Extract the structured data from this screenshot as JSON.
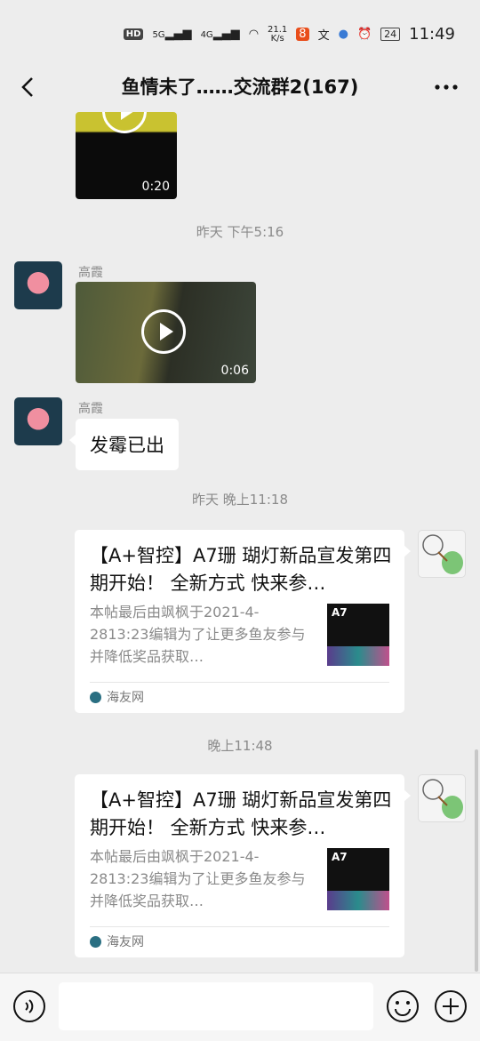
{
  "status": {
    "hd": "HD",
    "net1": "5G",
    "net2": "4G",
    "speed": "21.1\nK/s",
    "battery": "24",
    "time": "11:49"
  },
  "nav": {
    "title": "鱼情未了……交流群2(167)"
  },
  "messages": {
    "video1": {
      "duration": "0:20"
    },
    "sep1": "昨天 下午5:16",
    "msg1": {
      "sender": "高霞",
      "duration": "0:06"
    },
    "msg2": {
      "sender": "高霞",
      "text": "发霉已出"
    },
    "sep2": "昨天 晚上11:18",
    "card1": {
      "title": "【A+智控】A7珊 瑚灯新品宣发第四期开始！ 全新方式  快来参…",
      "desc": "本帖最后由飒枫于2021-4-2813:23编辑为了让更多鱼友参与并降低奖品获取…",
      "thumb": "A7",
      "source": "海友网"
    },
    "sep3": "晚上11:48",
    "card2": {
      "title": "【A+智控】A7珊 瑚灯新品宣发第四期开始！ 全新方式  快来参…",
      "desc": "本帖最后由飒枫于2021-4-2813:23编辑为了让更多鱼友参与并降低奖品获取…",
      "thumb": "A7",
      "source": "海友网"
    }
  },
  "icons": {
    "back": "back-arrow-icon",
    "more": "more-dots-icon",
    "voice": "voice-icon",
    "emoji": "emoji-icon",
    "plus": "plus-icon"
  }
}
